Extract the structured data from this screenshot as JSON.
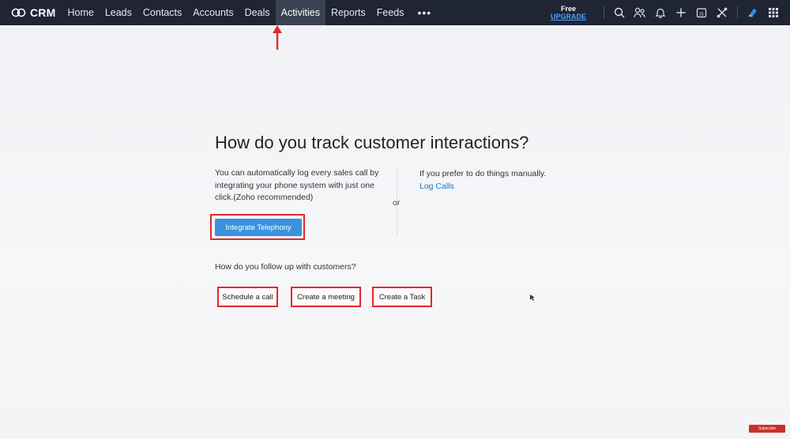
{
  "brand": {
    "name": "CRM"
  },
  "nav": {
    "items": [
      {
        "label": "Home",
        "active": false
      },
      {
        "label": "Leads",
        "active": false
      },
      {
        "label": "Contacts",
        "active": false
      },
      {
        "label": "Accounts",
        "active": false
      },
      {
        "label": "Deals",
        "active": false
      },
      {
        "label": "Activities",
        "active": true
      },
      {
        "label": "Reports",
        "active": false
      },
      {
        "label": "Feeds",
        "active": false
      }
    ],
    "more": "•••"
  },
  "upgrade": {
    "free": "Free",
    "link": "UPGRADE"
  },
  "calendar_day": "31",
  "main": {
    "title": "How do you track customer interactions?",
    "auto_text": "You can automatically log every sales call by integrating your phone system with just one click.(Zoho recommended)",
    "or": "or",
    "manual_text": "If you prefer to do things manually.",
    "log_calls": "Log Calls",
    "integrate_button": "Integrate Telephony",
    "followup_title": "How do you follow up with customers?",
    "schedule_call": "Schedule a call",
    "create_meeting": "Create a meeting",
    "create_task": "Create a Task"
  },
  "watermark": "Subscribe",
  "colors": {
    "topbar": "#1f2533",
    "accent": "#3a93e0",
    "highlight": "#e0282e",
    "link": "#1a73c8"
  }
}
